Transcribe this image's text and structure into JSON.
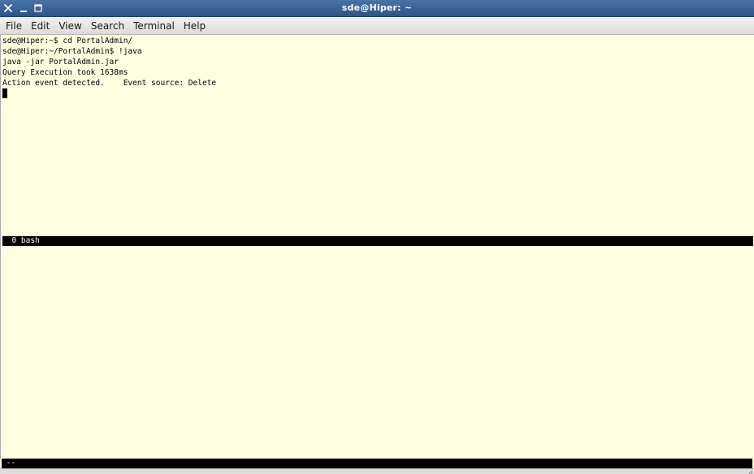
{
  "window": {
    "title": "sde@Hiper: ~"
  },
  "menu": [
    {
      "label": "File"
    },
    {
      "label": "Edit"
    },
    {
      "label": "View"
    },
    {
      "label": "Search"
    },
    {
      "label": "Terminal"
    },
    {
      "label": "Help"
    }
  ],
  "terminal": {
    "lines": [
      "sde@Hiper:~$ cd PortalAdmin/",
      "sde@Hiper:~/PortalAdmin$ !java",
      "java -jar PortalAdmin.jar",
      "Query Execution took 1638ms",
      "Action event detected.    Event source: Delete"
    ],
    "pane_status": "  0 bash",
    "bottom_status": " --"
  },
  "colors": {
    "terminal_bg": "#fefee0",
    "title_bar": "#3a639a",
    "status_bar": "#000000"
  }
}
